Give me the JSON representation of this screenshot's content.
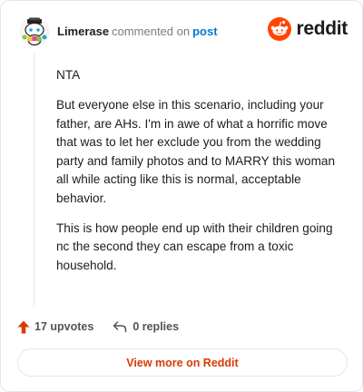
{
  "header": {
    "username": "Limerase",
    "action_text": "commented on",
    "post_link": "post",
    "brand_name": "reddit",
    "avatar_icon": "snoo-avatar-icon",
    "brand_icon": "reddit-snoo-icon"
  },
  "comment": {
    "paragraphs": [
      "NTA",
      "But everyone else in this scenario, including your father, are AHs. I'm in awe of what a horrific move that was to let her exclude you from the wedding party and family photos and to MARRY this woman all while acting like this is normal, acceptable behavior.",
      "This is how people end up with their children going nc the second they can escape from a toxic household."
    ]
  },
  "footer": {
    "upvotes": "17 upvotes",
    "replies": "0 replies",
    "upvote_icon": "upvote-arrow-icon",
    "reply_icon": "reply-arrow-icon"
  },
  "cta": {
    "label": "View more on Reddit"
  },
  "colors": {
    "brand_orange": "#ff4500",
    "upvote_orange": "#d93a00",
    "link_blue": "#0079d3",
    "border": "#e3e6e8",
    "muted_text": "#7c7c7c"
  }
}
